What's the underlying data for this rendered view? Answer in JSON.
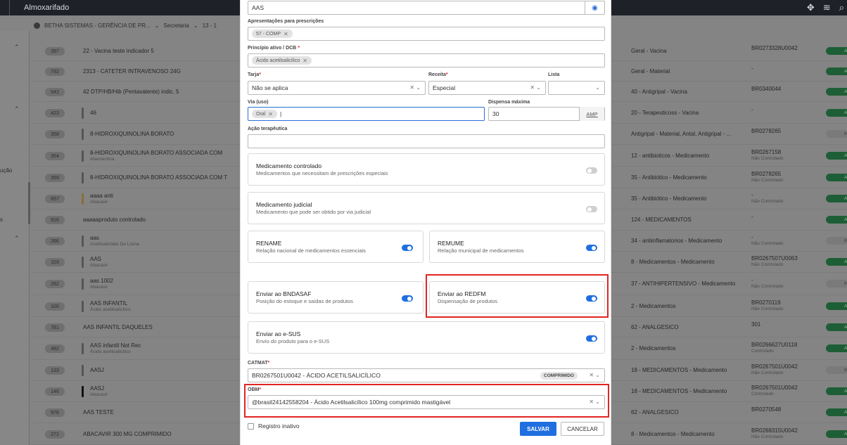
{
  "app": {
    "title": "Almoxarifado"
  },
  "subbar": {
    "org": "BETHA SISTEMAS - GERÊNCIA DE PR...",
    "entity": "Secretaria",
    "extra": "13 - 1"
  },
  "leftnav": {
    "label_a": "ução",
    "label_b": "s"
  },
  "rows": [
    {
      "id": "397",
      "name": "22 - Vacina teste indicador 5",
      "sub": "",
      "group": "Geral - Vacina",
      "code": "BR0273328U0042",
      "codesub": "",
      "status": "Ati",
      "bar": ""
    },
    {
      "id": "792",
      "name": "2313 - CATETER INTRAVENOSO 24G",
      "sub": "",
      "group": "Geral - Material",
      "code": "-",
      "codesub": "",
      "status": "Ati",
      "bar": ""
    },
    {
      "id": "542",
      "name": "42 DTP/HB/Hib (Pentavalente) indic. 5",
      "sub": "",
      "group": "40 - Antigripal - Vacina",
      "code": "BR0340044",
      "codesub": "",
      "status": "Ati",
      "bar": ""
    },
    {
      "id": "423",
      "name": "46",
      "sub": "",
      "group": "20 - Terapeuticoss - Vacina",
      "code": "-",
      "codesub": "",
      "status": "Ati",
      "bar": "#555"
    },
    {
      "id": "358",
      "name": "8-HIDROXIQUINOLINA BORATO",
      "sub": "",
      "group": "Antigripal - Material, Antal, Antigripal - ...",
      "code": "BR0278265",
      "codesub": "",
      "status": "Inat",
      "bar": "#555"
    },
    {
      "id": "354",
      "name": "8-HIDROXIQUINOLINA BORATO ASSOCIADA COM",
      "sub": "Abamectina",
      "group": "12 - antibioticos - Medicamento",
      "code": "BR0267158",
      "codesub": "Não Controlado",
      "status": "Ati",
      "bar": "#555"
    },
    {
      "id": "359",
      "name": "8-HIDROXIQUINOLINA BORATO ASSOCIADA COM T",
      "sub": "",
      "group": "35 - Antibiótico - Medicamento",
      "code": "BR0278265",
      "codesub": "Não Controlado",
      "status": "Ati",
      "bar": "#555"
    },
    {
      "id": "657",
      "name": "aaaa anti",
      "sub": "Abacavir",
      "group": "35 - Antibiótico - Medicamento",
      "code": "-",
      "codesub": "Não Controlado",
      "status": "Ati",
      "bar": "#8a6d3a"
    },
    {
      "id": "916",
      "name": "aaaaaproduto controlado",
      "sub": "",
      "group": "124 - MEDICAMENTOS",
      "code": "-",
      "codesub": "",
      "status": "Ati",
      "bar": ""
    },
    {
      "id": "266",
      "name": "aas",
      "sub": "Acetilsalicilato De Lisina",
      "group": "34 - antiinflamatorios - Medicamento",
      "code": "-",
      "codesub": "Não Controlado",
      "status": "Inat",
      "bar": "#555"
    },
    {
      "id": "103",
      "name": "AAS",
      "sub": "Abacavir",
      "group": "8 - Medicamentos - Medicamento",
      "code": "BR0267507U0063",
      "codesub": "Não Controlado",
      "status": "Ati",
      "bar": "#555"
    },
    {
      "id": "262",
      "name": "aas 1002",
      "sub": "Abacavir",
      "group": "37 - ANTIHIPERTENSIVO - Medicamento",
      "code": "-",
      "codesub": "Não Controlado",
      "status": "Inat",
      "bar": "#555"
    },
    {
      "id": "100",
      "name": "AAS INFANTIL",
      "sub": "Ácido acetilsalicílico",
      "group": "2 - Medicamentos",
      "code": "BR0270119",
      "codesub": "Não Controlado",
      "status": "Ati",
      "bar": "#555"
    },
    {
      "id": "781",
      "name": "AAS INFANTIL DAQUELES",
      "sub": "",
      "group": "62 - ANALGESICO",
      "code": "301",
      "codesub": "",
      "status": "Ati",
      "bar": ""
    },
    {
      "id": "482",
      "name": "AAS infantil Not Rec",
      "sub": "Ácido acetilsalicílico",
      "group": "2 - Medicamentos",
      "code": "BR0266627U0118",
      "codesub": "Controlado",
      "status": "Ati",
      "bar": "#555"
    },
    {
      "id": "133",
      "name": "AASJ",
      "sub": "",
      "group": "18 - MEDICAMENTOS - Medicamento",
      "code": "BR0267501U0042",
      "codesub": "Não Controlado",
      "status": "Inat",
      "bar": "#555"
    },
    {
      "id": "146",
      "name": "AASJ",
      "sub": "Abacavir",
      "group": "18 - MEDICAMENTOS - Medicamento",
      "code": "BR0267501U0042",
      "codesub": "Controlado",
      "status": "Ati",
      "bar": "#111"
    },
    {
      "id": "976",
      "name": "AAS TESTE",
      "sub": "",
      "group": "62 - ANALGESICO",
      "code": "BR0270548",
      "codesub": "",
      "status": "Ati",
      "bar": ""
    },
    {
      "id": "272",
      "name": "ABACAVIR 300 MG COMPRIMIDO",
      "sub": "",
      "group": "8 - Medicamentos - Medicamento",
      "code": "BR0268315U0042",
      "codesub": "Não Controlado",
      "status": "Ati",
      "bar": ""
    }
  ],
  "modal": {
    "name_value": "AAS",
    "apresentacoes": {
      "label": "Apresentações para prescrições",
      "chips": [
        "57 - COMP"
      ]
    },
    "principio": {
      "label": "Princípio ativo / DCB",
      "chips": [
        "Ácido acetilsalicílico"
      ]
    },
    "tarja": {
      "label": "Tarja",
      "value": "Não se aplica"
    },
    "receita": {
      "label": "Receita",
      "value": "Especial"
    },
    "lista": {
      "label": "Lista",
      "value": ""
    },
    "via": {
      "label": "Via (uso)",
      "chips": [
        "Oral"
      ]
    },
    "dispensa": {
      "label": "Dispensa máxima",
      "value": "30",
      "unit": "AMP"
    },
    "acao": {
      "label": "Ação terapêutica",
      "value": ""
    },
    "cards": {
      "controlado": {
        "title": "Medicamento controlado",
        "desc": "Medicamentos que necessitam de prescrições especiais",
        "on": false
      },
      "judicial": {
        "title": "Medicamento judicial",
        "desc": "Medicamento que pode ser obtido por via judicial",
        "on": false
      },
      "rename": {
        "title": "RENAME",
        "desc": "Relação nacional de medicamentos essenciais",
        "on": true
      },
      "remume": {
        "title": "REMUME",
        "desc": "Relação municipal de medicamentos",
        "on": true
      },
      "bndasaf": {
        "title": "Enviar ao BNDASAF",
        "desc": "Posição do estoque e saídas de produtos",
        "on": true
      },
      "redfm": {
        "title": "Enviar ao REDFM",
        "desc": "Dispensação de produtos",
        "on": true
      },
      "esus": {
        "title": "Enviar ao e-SUS",
        "desc": "Envio do produto para o e-SUS",
        "on": true
      }
    },
    "catmat": {
      "label": "CATMAT",
      "value": "BR0267501U0042 - ÁCIDO ACETILSALICÍLICO",
      "badge": "COMPRIMIDO"
    },
    "obm": {
      "label": "OBM",
      "value": "@brasil24142558204 - Ácido Acetilsalicílico 100mg comprimido mastigável"
    },
    "registro_inativo": "Registro inativo",
    "save": "SALVAR",
    "cancel": "CANCELAR"
  },
  "colors": {
    "accent": "#1f6fe0",
    "highlight": "#e02424",
    "topbar": "#1e2228"
  }
}
